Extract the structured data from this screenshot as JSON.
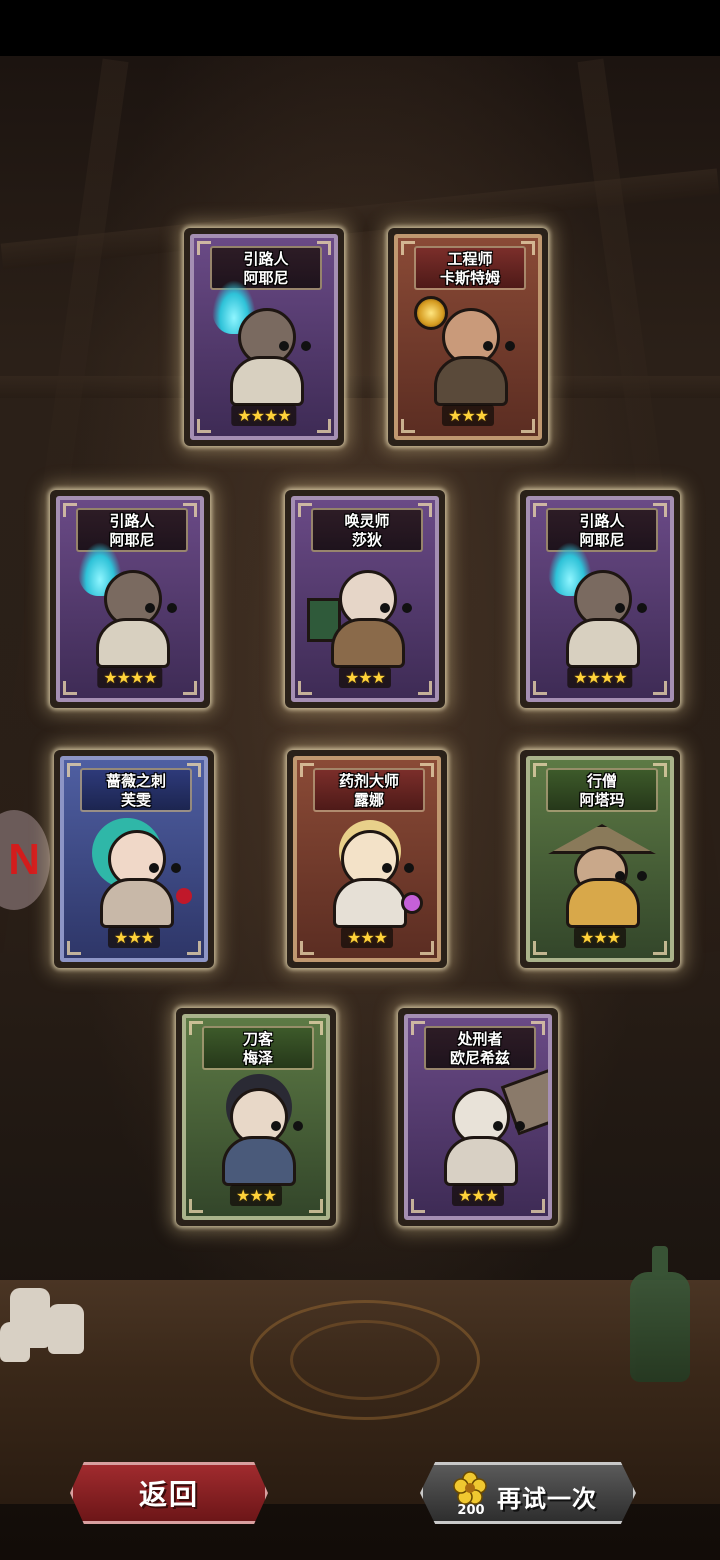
{
  "cards": [
    {
      "line1": "引路人",
      "line2": "阿耶尼",
      "stars": "★★★★",
      "theme": "purple",
      "hero": "torch-bearer"
    },
    {
      "line1": "工程师",
      "line2": "卡斯特姆",
      "stars": "★★★",
      "theme": "rust",
      "hero": "engineer"
    },
    {
      "line1": "引路人",
      "line2": "阿耶尼",
      "stars": "★★★★",
      "theme": "purple",
      "hero": "torch-bearer"
    },
    {
      "line1": "唤灵师",
      "line2": "莎狄",
      "stars": "★★★",
      "theme": "purple",
      "hero": "summoner"
    },
    {
      "line1": "引路人",
      "line2": "阿耶尼",
      "stars": "★★★★",
      "theme": "purple",
      "hero": "torch-bearer"
    },
    {
      "line1": "蔷薇之刺",
      "line2": "芙雯",
      "stars": "★★★",
      "theme": "blue",
      "hero": "rose-thorn"
    },
    {
      "line1": "药剂大师",
      "line2": "露娜",
      "stars": "★★★",
      "theme": "rust",
      "hero": "alchemist"
    },
    {
      "line1": "行僧",
      "line2": "阿塔玛",
      "stars": "★★★",
      "theme": "green",
      "hero": "monk"
    },
    {
      "line1": "刀客",
      "line2": "梅泽",
      "stars": "★★★",
      "theme": "green",
      "hero": "swordsman"
    },
    {
      "line1": "处刑者",
      "line2": "欧尼希兹",
      "stars": "★★★",
      "theme": "purple",
      "hero": "executioner"
    }
  ],
  "buttons": {
    "back_label": "返回",
    "retry_label": "再试一次",
    "retry_cost": "200"
  },
  "colors": {
    "star": "#ffd23a",
    "back_button": "#a02b2e",
    "retry_button": "#4a4a4a"
  }
}
